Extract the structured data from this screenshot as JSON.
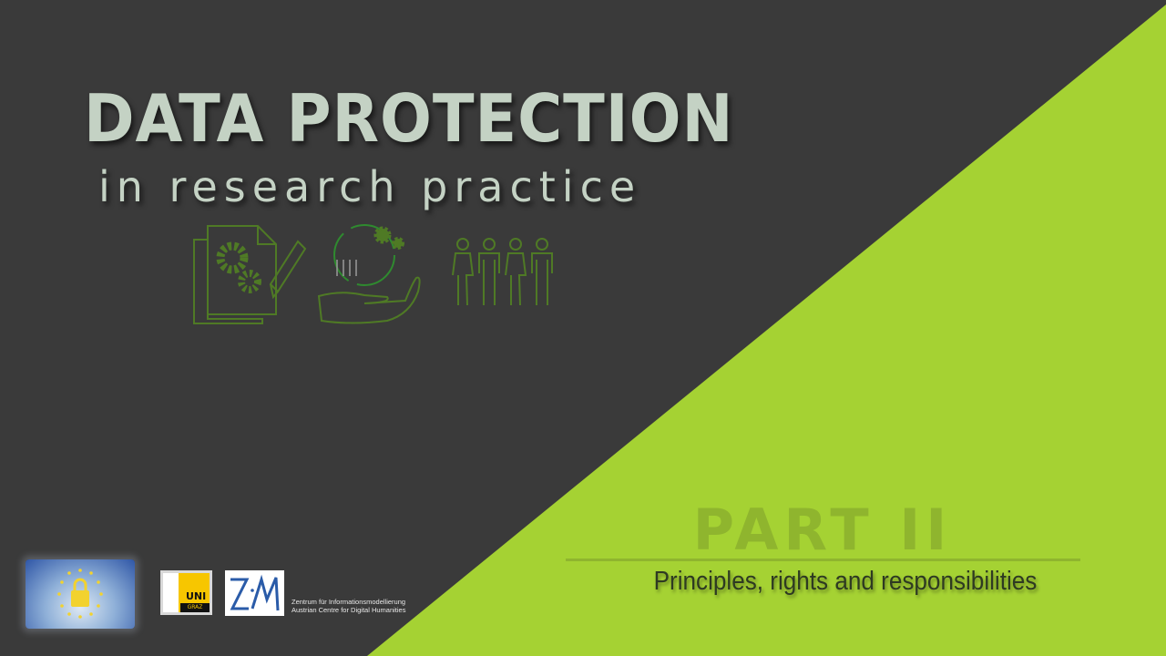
{
  "title": "DATA PROTECTION",
  "subtitle": "in research practice",
  "icons": [
    "document-gears-pencil-icon",
    "hand-gears-people-icon",
    "people-group-icon"
  ],
  "part": {
    "label": "PART II",
    "subtitle": "Principles, rights and responsibilities"
  },
  "logos": {
    "gdpr": {
      "text": "GDPR"
    },
    "uni_graz": {
      "line1": "UNI",
      "line2": "GRAZ"
    },
    "zim": {
      "text": "ZiM",
      "line1": "Zentrum für Informationsmodellierung",
      "line2": "Austrian Centre for Digital Humanities"
    }
  },
  "colors": {
    "background": "#3a3a3a",
    "accent_green": "#a5d233",
    "icon_green": "#4f7a25",
    "title": "#c4d2c4"
  }
}
